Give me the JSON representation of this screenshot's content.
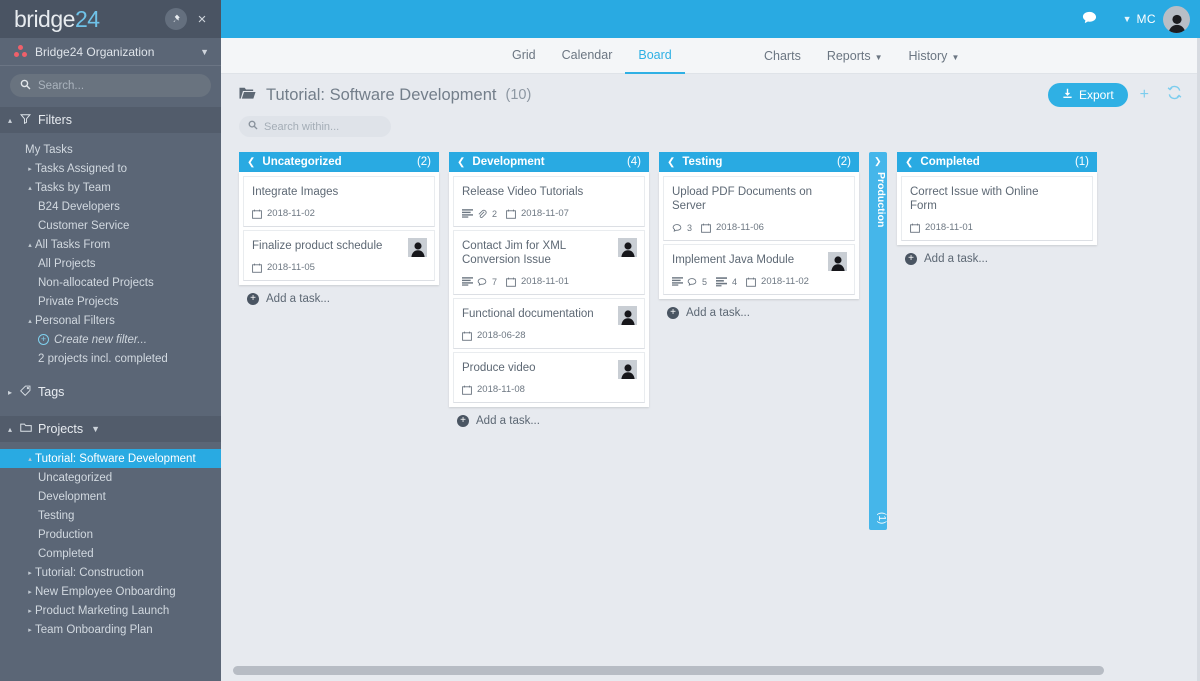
{
  "sidebar": {
    "brand": {
      "part1": "bridge",
      "part2": "24"
    },
    "pin_icon": "pin-icon",
    "close_label": "×",
    "organization": {
      "label": "Bridge24 Organization",
      "caret": "▼"
    },
    "search": {
      "placeholder": "Search...",
      "value": ""
    },
    "sections": {
      "filters": {
        "label": "Filters",
        "icon": "funnel-icon",
        "caret": "▴"
      },
      "tags": {
        "label": "Tags",
        "icon": "tag-icon",
        "caret": "▸"
      },
      "projects": {
        "label": "Projects",
        "icon": "folder-icon",
        "caret": "▴",
        "extra_caret": "▼"
      }
    },
    "filter_items": [
      {
        "label": "My Tasks",
        "caret": "",
        "level": 1
      },
      {
        "label": "Tasks Assigned to",
        "caret": "▸",
        "level": 1
      },
      {
        "label": "Tasks by Team",
        "caret": "▴",
        "level": 1
      },
      {
        "label": "B24 Developers",
        "caret": "",
        "level": 2
      },
      {
        "label": "Customer Service",
        "caret": "",
        "level": 2
      },
      {
        "label": "All Tasks From",
        "caret": "▴",
        "level": 1
      },
      {
        "label": "All Projects",
        "caret": "",
        "level": 2
      },
      {
        "label": "Non-allocated Projects",
        "caret": "",
        "level": 2
      },
      {
        "label": "Private Projects",
        "caret": "",
        "level": 2
      },
      {
        "label": "Personal Filters",
        "caret": "▴",
        "level": 1
      },
      {
        "label": "Create new filter...",
        "caret": "",
        "level": 2,
        "style": "create"
      },
      {
        "label": "2 projects incl. completed",
        "caret": "",
        "level": 2
      }
    ],
    "project_items": [
      {
        "label": "Tutorial: Software Development",
        "caret": "▴",
        "level": 1,
        "active": true
      },
      {
        "label": "Uncategorized",
        "caret": "",
        "level": 2
      },
      {
        "label": "Development",
        "caret": "",
        "level": 2
      },
      {
        "label": "Testing",
        "caret": "",
        "level": 2
      },
      {
        "label": "Production",
        "caret": "",
        "level": 2
      },
      {
        "label": "Completed",
        "caret": "",
        "level": 2
      },
      {
        "label": "Tutorial: Construction",
        "caret": "▸",
        "level": 1
      },
      {
        "label": "New Employee Onboarding",
        "caret": "▸",
        "level": 1
      },
      {
        "label": "Product Marketing Launch",
        "caret": "▸",
        "level": 1
      },
      {
        "label": "Team Onboarding Plan",
        "caret": "▸",
        "level": 1
      }
    ]
  },
  "topbar": {
    "chat_icon": "chat-bubble-icon",
    "user_caret": "▼",
    "user_initials": "MC",
    "avatar_icon": "user-avatar"
  },
  "navbar": {
    "tabs": [
      {
        "label": "Grid",
        "active": false
      },
      {
        "label": "Calendar",
        "active": false
      },
      {
        "label": "Board",
        "active": true
      }
    ],
    "links": [
      {
        "label": "Charts",
        "caret": ""
      },
      {
        "label": "Reports",
        "caret": "▼"
      },
      {
        "label": "History",
        "caret": "▼"
      }
    ]
  },
  "project_header": {
    "folder_icon": "folder-open-icon",
    "title": "Tutorial: Software Development",
    "count": "(10)",
    "export_label": "Export",
    "export_icon": "download-icon",
    "add_icon": "+",
    "refresh_icon": "↻"
  },
  "search_within": {
    "placeholder": "Search within...",
    "value": ""
  },
  "board": {
    "add_task_label": "Add a task...",
    "columns": [
      {
        "name": "Uncategorized",
        "count": "(2)",
        "collapsed": false,
        "cards": [
          {
            "title": "Integrate Images",
            "date": "2018-11-02",
            "avatar": false,
            "icons": []
          },
          {
            "title": "Finalize product schedule",
            "date": "2018-11-05",
            "avatar": true,
            "icons": []
          }
        ]
      },
      {
        "name": "Development",
        "count": "(4)",
        "collapsed": false,
        "cards": [
          {
            "title": "Release Video Tutorials",
            "date": "2018-11-07",
            "avatar": false,
            "icons": [
              {
                "type": "description",
                "n": ""
              },
              {
                "type": "attachment",
                "n": "2"
              }
            ]
          },
          {
            "title": "Contact Jim for XML Conversion Issue",
            "date": "2018-11-01",
            "avatar": true,
            "icons": [
              {
                "type": "description",
                "n": ""
              },
              {
                "type": "comment",
                "n": "7"
              }
            ]
          },
          {
            "title": "Functional documentation",
            "date": "2018-06-28",
            "avatar": true,
            "icons": []
          },
          {
            "title": "Produce video",
            "date": "2018-11-08",
            "avatar": true,
            "icons": []
          }
        ]
      },
      {
        "name": "Testing",
        "count": "(2)",
        "collapsed": false,
        "cards": [
          {
            "title": "Upload PDF Documents on Server",
            "date": "2018-11-06",
            "avatar": false,
            "icons": [
              {
                "type": "comment",
                "n": "3"
              }
            ]
          },
          {
            "title": "Implement Java Module",
            "date": "2018-11-02",
            "avatar": true,
            "icons": [
              {
                "type": "description",
                "n": ""
              },
              {
                "type": "comment",
                "n": "5"
              },
              {
                "type": "subtask",
                "n": "4"
              }
            ]
          }
        ]
      },
      {
        "name": "Production",
        "count": "(1)",
        "collapsed": true,
        "cards": []
      },
      {
        "name": "Completed",
        "count": "(1)",
        "collapsed": false,
        "cards": [
          {
            "title": "Correct Issue with Online Form",
            "date": "2018-11-01",
            "avatar": false,
            "icons": []
          }
        ]
      }
    ]
  },
  "colors": {
    "accent": "#29aae2",
    "sidebar_bg": "#5b6676",
    "board_bg": "#e7eaef",
    "org_dot": "#f0606a"
  }
}
